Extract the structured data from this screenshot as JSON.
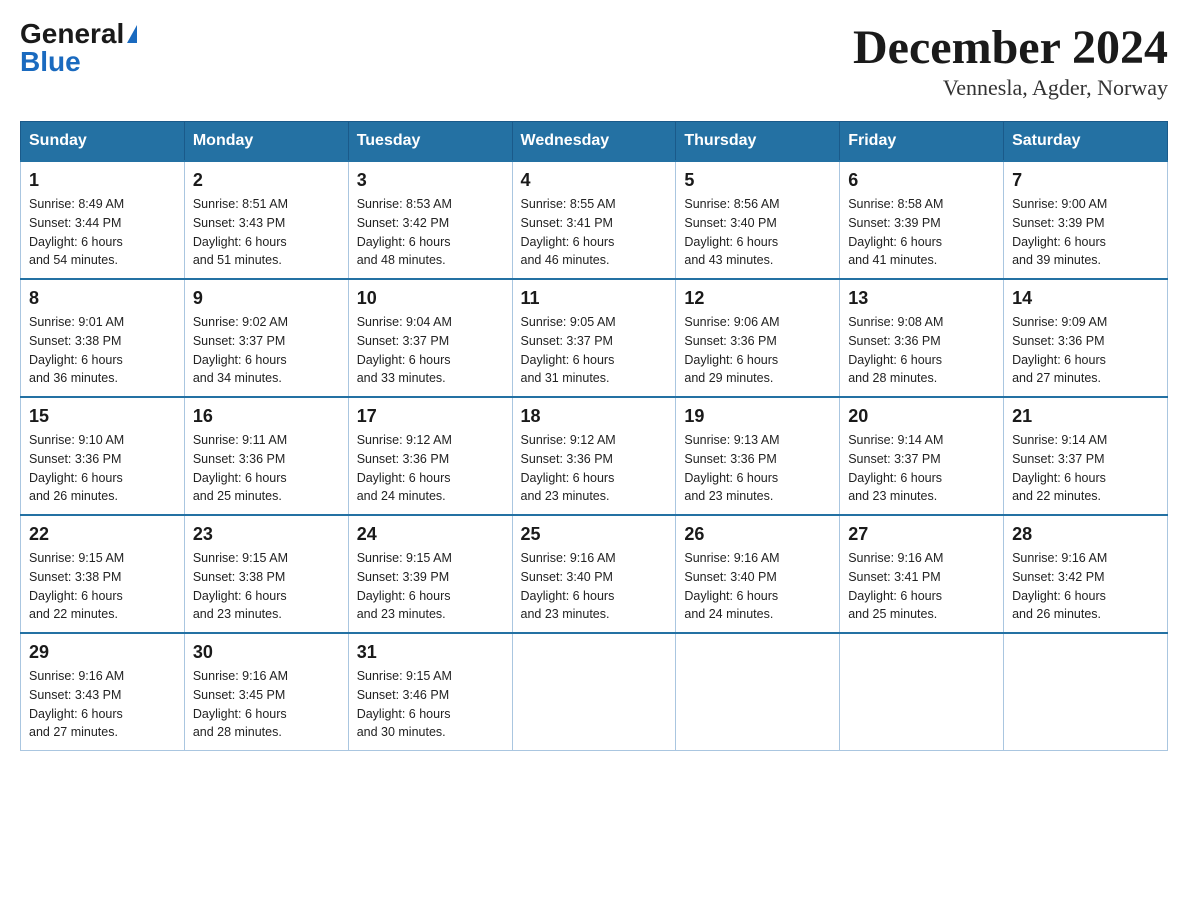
{
  "logo": {
    "general": "General",
    "blue": "Blue"
  },
  "title": "December 2024",
  "subtitle": "Vennesla, Agder, Norway",
  "days_of_week": [
    "Sunday",
    "Monday",
    "Tuesday",
    "Wednesday",
    "Thursday",
    "Friday",
    "Saturday"
  ],
  "weeks": [
    [
      {
        "day": "1",
        "sunrise": "8:49 AM",
        "sunset": "3:44 PM",
        "daylight": "6 hours and 54 minutes."
      },
      {
        "day": "2",
        "sunrise": "8:51 AM",
        "sunset": "3:43 PM",
        "daylight": "6 hours and 51 minutes."
      },
      {
        "day": "3",
        "sunrise": "8:53 AM",
        "sunset": "3:42 PM",
        "daylight": "6 hours and 48 minutes."
      },
      {
        "day": "4",
        "sunrise": "8:55 AM",
        "sunset": "3:41 PM",
        "daylight": "6 hours and 46 minutes."
      },
      {
        "day": "5",
        "sunrise": "8:56 AM",
        "sunset": "3:40 PM",
        "daylight": "6 hours and 43 minutes."
      },
      {
        "day": "6",
        "sunrise": "8:58 AM",
        "sunset": "3:39 PM",
        "daylight": "6 hours and 41 minutes."
      },
      {
        "day": "7",
        "sunrise": "9:00 AM",
        "sunset": "3:39 PM",
        "daylight": "6 hours and 39 minutes."
      }
    ],
    [
      {
        "day": "8",
        "sunrise": "9:01 AM",
        "sunset": "3:38 PM",
        "daylight": "6 hours and 36 minutes."
      },
      {
        "day": "9",
        "sunrise": "9:02 AM",
        "sunset": "3:37 PM",
        "daylight": "6 hours and 34 minutes."
      },
      {
        "day": "10",
        "sunrise": "9:04 AM",
        "sunset": "3:37 PM",
        "daylight": "6 hours and 33 minutes."
      },
      {
        "day": "11",
        "sunrise": "9:05 AM",
        "sunset": "3:37 PM",
        "daylight": "6 hours and 31 minutes."
      },
      {
        "day": "12",
        "sunrise": "9:06 AM",
        "sunset": "3:36 PM",
        "daylight": "6 hours and 29 minutes."
      },
      {
        "day": "13",
        "sunrise": "9:08 AM",
        "sunset": "3:36 PM",
        "daylight": "6 hours and 28 minutes."
      },
      {
        "day": "14",
        "sunrise": "9:09 AM",
        "sunset": "3:36 PM",
        "daylight": "6 hours and 27 minutes."
      }
    ],
    [
      {
        "day": "15",
        "sunrise": "9:10 AM",
        "sunset": "3:36 PM",
        "daylight": "6 hours and 26 minutes."
      },
      {
        "day": "16",
        "sunrise": "9:11 AM",
        "sunset": "3:36 PM",
        "daylight": "6 hours and 25 minutes."
      },
      {
        "day": "17",
        "sunrise": "9:12 AM",
        "sunset": "3:36 PM",
        "daylight": "6 hours and 24 minutes."
      },
      {
        "day": "18",
        "sunrise": "9:12 AM",
        "sunset": "3:36 PM",
        "daylight": "6 hours and 23 minutes."
      },
      {
        "day": "19",
        "sunrise": "9:13 AM",
        "sunset": "3:36 PM",
        "daylight": "6 hours and 23 minutes."
      },
      {
        "day": "20",
        "sunrise": "9:14 AM",
        "sunset": "3:37 PM",
        "daylight": "6 hours and 23 minutes."
      },
      {
        "day": "21",
        "sunrise": "9:14 AM",
        "sunset": "3:37 PM",
        "daylight": "6 hours and 22 minutes."
      }
    ],
    [
      {
        "day": "22",
        "sunrise": "9:15 AM",
        "sunset": "3:38 PM",
        "daylight": "6 hours and 22 minutes."
      },
      {
        "day": "23",
        "sunrise": "9:15 AM",
        "sunset": "3:38 PM",
        "daylight": "6 hours and 23 minutes."
      },
      {
        "day": "24",
        "sunrise": "9:15 AM",
        "sunset": "3:39 PM",
        "daylight": "6 hours and 23 minutes."
      },
      {
        "day": "25",
        "sunrise": "9:16 AM",
        "sunset": "3:40 PM",
        "daylight": "6 hours and 23 minutes."
      },
      {
        "day": "26",
        "sunrise": "9:16 AM",
        "sunset": "3:40 PM",
        "daylight": "6 hours and 24 minutes."
      },
      {
        "day": "27",
        "sunrise": "9:16 AM",
        "sunset": "3:41 PM",
        "daylight": "6 hours and 25 minutes."
      },
      {
        "day": "28",
        "sunrise": "9:16 AM",
        "sunset": "3:42 PM",
        "daylight": "6 hours and 26 minutes."
      }
    ],
    [
      {
        "day": "29",
        "sunrise": "9:16 AM",
        "sunset": "3:43 PM",
        "daylight": "6 hours and 27 minutes."
      },
      {
        "day": "30",
        "sunrise": "9:16 AM",
        "sunset": "3:45 PM",
        "daylight": "6 hours and 28 minutes."
      },
      {
        "day": "31",
        "sunrise": "9:15 AM",
        "sunset": "3:46 PM",
        "daylight": "6 hours and 30 minutes."
      },
      null,
      null,
      null,
      null
    ]
  ],
  "labels": {
    "sunrise": "Sunrise:",
    "sunset": "Sunset:",
    "daylight": "Daylight:"
  }
}
